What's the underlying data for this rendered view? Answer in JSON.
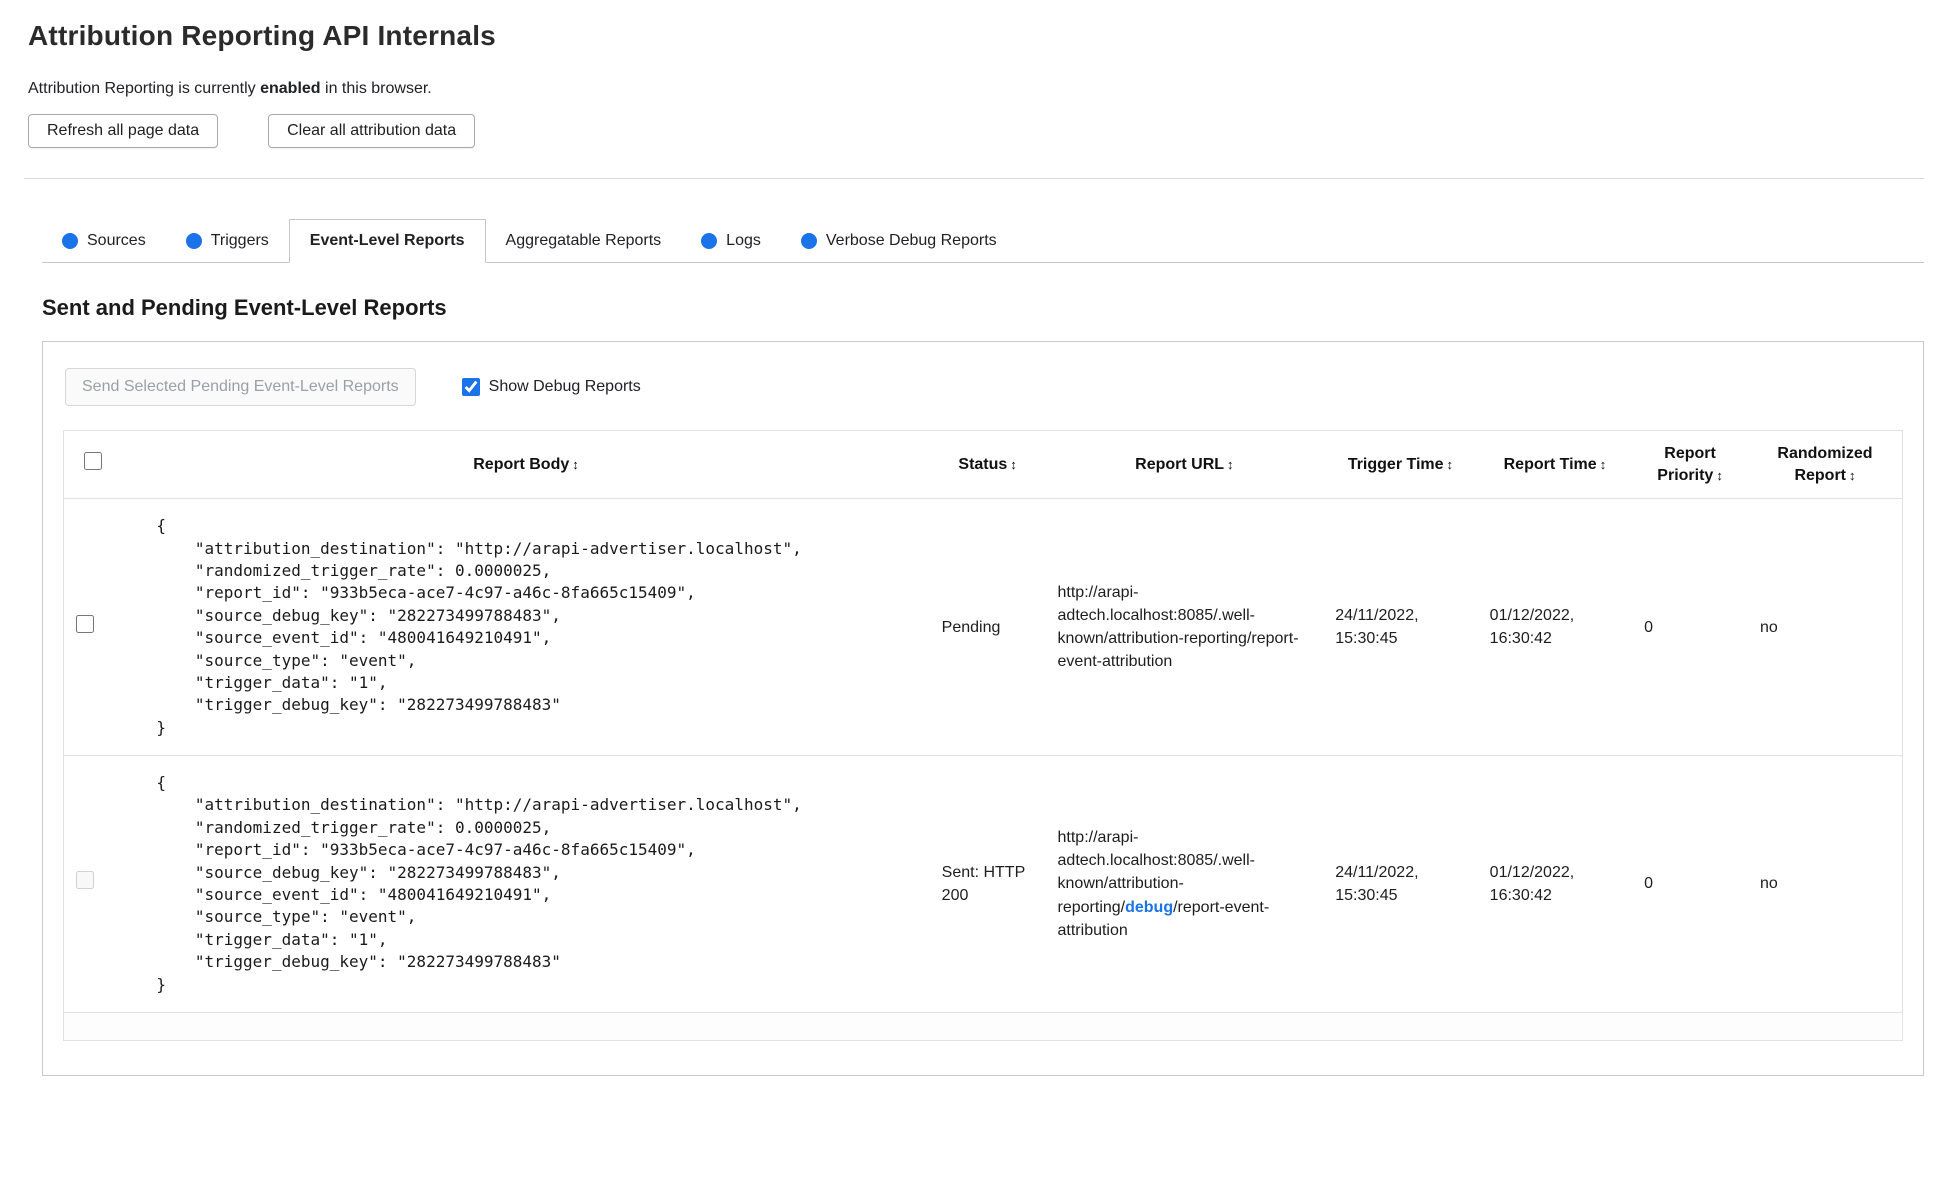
{
  "page": {
    "title": "Attribution Reporting API Internals",
    "status": {
      "prefix": "Attribution Reporting is currently ",
      "emphasis": "enabled",
      "suffix": " in this browser."
    },
    "buttons": {
      "refresh": "Refresh all page data",
      "clear": "Clear all attribution data"
    }
  },
  "colors": {
    "accent_blue": "#1a73e8"
  },
  "tabs": [
    {
      "label": "Sources",
      "has_dot": true,
      "active": false
    },
    {
      "label": "Triggers",
      "has_dot": true,
      "active": false
    },
    {
      "label": "Event-Level Reports",
      "has_dot": false,
      "active": true
    },
    {
      "label": "Aggregatable Reports",
      "has_dot": false,
      "active": false
    },
    {
      "label": "Logs",
      "has_dot": true,
      "active": false
    },
    {
      "label": "Verbose Debug Reports",
      "has_dot": true,
      "active": false
    }
  ],
  "section": {
    "heading": "Sent and Pending Event-Level Reports"
  },
  "controls": {
    "send_button": "Send Selected Pending Event-Level Reports",
    "send_button_disabled": true,
    "show_debug_label": "Show Debug Reports",
    "show_debug_checked": true
  },
  "table": {
    "sort_icon": "↕",
    "headers": [
      "Report Body",
      "Status",
      "Report URL",
      "Trigger Time",
      "Report Time",
      "Report Priority",
      "Randomized Report"
    ]
  },
  "rows": [
    {
      "body": "{\n    \"attribution_destination\": \"http://arapi-advertiser.localhost\",\n    \"randomized_trigger_rate\": 0.0000025,\n    \"report_id\": \"933b5eca-ace7-4c97-a46c-8fa665c15409\",\n    \"source_debug_key\": \"282273499788483\",\n    \"source_event_id\": \"480041649210491\",\n    \"source_type\": \"event\",\n    \"trigger_data\": \"1\",\n    \"trigger_debug_key\": \"282273499788483\"\n}",
      "status": "Pending",
      "url_prefix": "http://arapi-adtech.localhost:8085/.well-known/attribution-reporting/report-event-attribution",
      "url_debug": "",
      "url_suffix": "",
      "trigger_time": "24/11/2022, 15:30:45",
      "report_time": "01/12/2022, 16:30:42",
      "report_priority": "0",
      "randomized_report": "no",
      "checkbox_disabled": false
    },
    {
      "body": "{\n    \"attribution_destination\": \"http://arapi-advertiser.localhost\",\n    \"randomized_trigger_rate\": 0.0000025,\n    \"report_id\": \"933b5eca-ace7-4c97-a46c-8fa665c15409\",\n    \"source_debug_key\": \"282273499788483\",\n    \"source_event_id\": \"480041649210491\",\n    \"source_type\": \"event\",\n    \"trigger_data\": \"1\",\n    \"trigger_debug_key\": \"282273499788483\"\n}",
      "status": "Sent: HTTP 200",
      "url_prefix": "http://arapi-adtech.localhost:8085/.well-known/attribution-reporting/",
      "url_debug": "debug",
      "url_suffix": "/report-event-attribution",
      "trigger_time": "24/11/2022, 15:30:45",
      "report_time": "01/12/2022, 16:30:42",
      "report_priority": "0",
      "randomized_report": "no",
      "checkbox_disabled": true
    }
  ]
}
